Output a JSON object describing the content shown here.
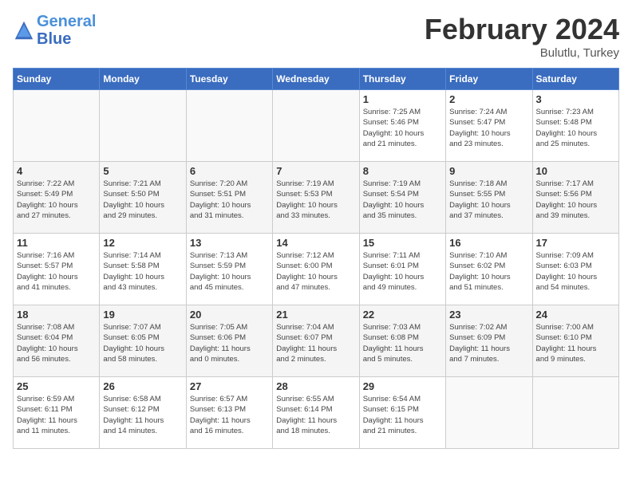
{
  "logo": {
    "line1": "General",
    "line2": "Blue"
  },
  "title": "February 2024",
  "subtitle": "Bulutlu, Turkey",
  "days_header": [
    "Sunday",
    "Monday",
    "Tuesday",
    "Wednesday",
    "Thursday",
    "Friday",
    "Saturday"
  ],
  "weeks": [
    [
      {
        "day": "",
        "info": ""
      },
      {
        "day": "",
        "info": ""
      },
      {
        "day": "",
        "info": ""
      },
      {
        "day": "",
        "info": ""
      },
      {
        "day": "1",
        "info": "Sunrise: 7:25 AM\nSunset: 5:46 PM\nDaylight: 10 hours\nand 21 minutes."
      },
      {
        "day": "2",
        "info": "Sunrise: 7:24 AM\nSunset: 5:47 PM\nDaylight: 10 hours\nand 23 minutes."
      },
      {
        "day": "3",
        "info": "Sunrise: 7:23 AM\nSunset: 5:48 PM\nDaylight: 10 hours\nand 25 minutes."
      }
    ],
    [
      {
        "day": "4",
        "info": "Sunrise: 7:22 AM\nSunset: 5:49 PM\nDaylight: 10 hours\nand 27 minutes."
      },
      {
        "day": "5",
        "info": "Sunrise: 7:21 AM\nSunset: 5:50 PM\nDaylight: 10 hours\nand 29 minutes."
      },
      {
        "day": "6",
        "info": "Sunrise: 7:20 AM\nSunset: 5:51 PM\nDaylight: 10 hours\nand 31 minutes."
      },
      {
        "day": "7",
        "info": "Sunrise: 7:19 AM\nSunset: 5:53 PM\nDaylight: 10 hours\nand 33 minutes."
      },
      {
        "day": "8",
        "info": "Sunrise: 7:19 AM\nSunset: 5:54 PM\nDaylight: 10 hours\nand 35 minutes."
      },
      {
        "day": "9",
        "info": "Sunrise: 7:18 AM\nSunset: 5:55 PM\nDaylight: 10 hours\nand 37 minutes."
      },
      {
        "day": "10",
        "info": "Sunrise: 7:17 AM\nSunset: 5:56 PM\nDaylight: 10 hours\nand 39 minutes."
      }
    ],
    [
      {
        "day": "11",
        "info": "Sunrise: 7:16 AM\nSunset: 5:57 PM\nDaylight: 10 hours\nand 41 minutes."
      },
      {
        "day": "12",
        "info": "Sunrise: 7:14 AM\nSunset: 5:58 PM\nDaylight: 10 hours\nand 43 minutes."
      },
      {
        "day": "13",
        "info": "Sunrise: 7:13 AM\nSunset: 5:59 PM\nDaylight: 10 hours\nand 45 minutes."
      },
      {
        "day": "14",
        "info": "Sunrise: 7:12 AM\nSunset: 6:00 PM\nDaylight: 10 hours\nand 47 minutes."
      },
      {
        "day": "15",
        "info": "Sunrise: 7:11 AM\nSunset: 6:01 PM\nDaylight: 10 hours\nand 49 minutes."
      },
      {
        "day": "16",
        "info": "Sunrise: 7:10 AM\nSunset: 6:02 PM\nDaylight: 10 hours\nand 51 minutes."
      },
      {
        "day": "17",
        "info": "Sunrise: 7:09 AM\nSunset: 6:03 PM\nDaylight: 10 hours\nand 54 minutes."
      }
    ],
    [
      {
        "day": "18",
        "info": "Sunrise: 7:08 AM\nSunset: 6:04 PM\nDaylight: 10 hours\nand 56 minutes."
      },
      {
        "day": "19",
        "info": "Sunrise: 7:07 AM\nSunset: 6:05 PM\nDaylight: 10 hours\nand 58 minutes."
      },
      {
        "day": "20",
        "info": "Sunrise: 7:05 AM\nSunset: 6:06 PM\nDaylight: 11 hours\nand 0 minutes."
      },
      {
        "day": "21",
        "info": "Sunrise: 7:04 AM\nSunset: 6:07 PM\nDaylight: 11 hours\nand 2 minutes."
      },
      {
        "day": "22",
        "info": "Sunrise: 7:03 AM\nSunset: 6:08 PM\nDaylight: 11 hours\nand 5 minutes."
      },
      {
        "day": "23",
        "info": "Sunrise: 7:02 AM\nSunset: 6:09 PM\nDaylight: 11 hours\nand 7 minutes."
      },
      {
        "day": "24",
        "info": "Sunrise: 7:00 AM\nSunset: 6:10 PM\nDaylight: 11 hours\nand 9 minutes."
      }
    ],
    [
      {
        "day": "25",
        "info": "Sunrise: 6:59 AM\nSunset: 6:11 PM\nDaylight: 11 hours\nand 11 minutes."
      },
      {
        "day": "26",
        "info": "Sunrise: 6:58 AM\nSunset: 6:12 PM\nDaylight: 11 hours\nand 14 minutes."
      },
      {
        "day": "27",
        "info": "Sunrise: 6:57 AM\nSunset: 6:13 PM\nDaylight: 11 hours\nand 16 minutes."
      },
      {
        "day": "28",
        "info": "Sunrise: 6:55 AM\nSunset: 6:14 PM\nDaylight: 11 hours\nand 18 minutes."
      },
      {
        "day": "29",
        "info": "Sunrise: 6:54 AM\nSunset: 6:15 PM\nDaylight: 11 hours\nand 21 minutes."
      },
      {
        "day": "",
        "info": ""
      },
      {
        "day": "",
        "info": ""
      }
    ]
  ]
}
